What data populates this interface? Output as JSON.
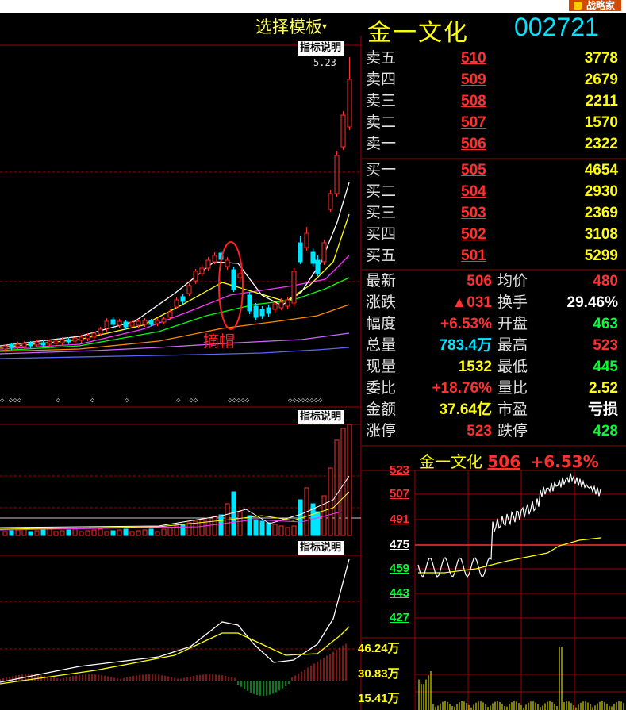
{
  "header": {
    "brand_button": "战略家",
    "template_label": "选择模板",
    "template_arrow": "▾",
    "stock_name": "金一文化",
    "stock_code": "002721"
  },
  "kline": {
    "indicator_button": "指标说明",
    "max_price_label": "5.23",
    "annotation_text": "摘帽",
    "diamond_markers": "◇ ◇◇◇        ◇       ◇       ◇           ◇  ◇◇       ◇◇◇◇◇         ◇◇◇◇◇◇◇◇"
  },
  "volume_panel": {
    "indicator_button": "指标说明"
  },
  "macd_panel": {
    "indicator_button": "指标说明"
  },
  "order_book": {
    "asks": [
      {
        "label": "卖五",
        "price": "510",
        "qty": "3778"
      },
      {
        "label": "卖四",
        "price": "509",
        "qty": "2679"
      },
      {
        "label": "卖三",
        "price": "508",
        "qty": "2211"
      },
      {
        "label": "卖二",
        "price": "507",
        "qty": "1570"
      },
      {
        "label": "卖一",
        "price": "506",
        "qty": "2322"
      }
    ],
    "bids": [
      {
        "label": "买一",
        "price": "505",
        "qty": "4654"
      },
      {
        "label": "买二",
        "price": "504",
        "qty": "2930"
      },
      {
        "label": "买三",
        "price": "503",
        "qty": "2369"
      },
      {
        "label": "买四",
        "price": "502",
        "qty": "3108"
      },
      {
        "label": "买五",
        "price": "501",
        "qty": "5299"
      }
    ]
  },
  "quote_stats": {
    "left": [
      {
        "label": "最新",
        "value": "506",
        "color": "#ff3030"
      },
      {
        "label": "涨跌",
        "value": "▲031",
        "color": "#ff3030"
      },
      {
        "label": "幅度",
        "value": "+6.53%",
        "color": "#ff3030"
      },
      {
        "label": "总量",
        "value": "783.4万",
        "color": "#00e5ff"
      },
      {
        "label": "现量",
        "value": "1532",
        "color": "#ffff00"
      },
      {
        "label": "委比",
        "value": "+18.76%",
        "color": "#ff3030"
      },
      {
        "label": "金额",
        "value": "37.64亿",
        "color": "#ffff00"
      },
      {
        "label": "涨停",
        "value": "523",
        "color": "#ff3030"
      }
    ],
    "right": [
      {
        "label": "均价",
        "value": "480",
        "color": "#ff3030"
      },
      {
        "label": "换手",
        "value": "29.46%",
        "color": "#ffffff"
      },
      {
        "label": "开盘",
        "value": "463",
        "color": "#00ff33"
      },
      {
        "label": "最高",
        "value": "523",
        "color": "#ff3030"
      },
      {
        "label": "最低",
        "value": "445",
        "color": "#00ff33"
      },
      {
        "label": "量比",
        "value": "2.52",
        "color": "#ffff00"
      },
      {
        "label": "市盈",
        "value": "亏损",
        "color": "#ffffff"
      },
      {
        "label": "跌停",
        "value": "428",
        "color": "#00ff33"
      }
    ]
  },
  "intraday": {
    "name": "金一文化",
    "price": "506",
    "change": "+6.53%",
    "y_labels": [
      "523",
      "507",
      "491",
      "475",
      "459",
      "443",
      "427"
    ],
    "volume_labels": [
      "46.24万",
      "30.83万",
      "15.41万"
    ]
  },
  "colors": {
    "up": "#ff3030",
    "down": "#00e5ff",
    "grid": "#a00000",
    "ma_white": "#ffffff",
    "ma_yellow": "#ffff00",
    "ma_magenta": "#ff33ff",
    "ma_green": "#00ff00",
    "ma_orange": "#ff8800",
    "ma_purple": "#cc66ff",
    "ma_blue": "#5566ff"
  }
}
